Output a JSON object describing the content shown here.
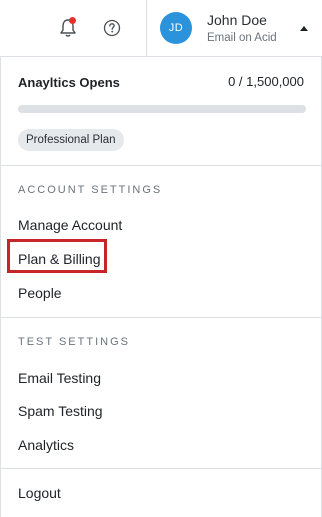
{
  "header": {
    "bell_icon": "bell-icon",
    "help_icon": "question-circle-icon",
    "notification_dot_color": "#e1342b"
  },
  "user": {
    "initials": "JD",
    "name": "John Doe",
    "company": "Email on Acid",
    "avatar_color": "#2b93dc"
  },
  "usage": {
    "title": "Anayltics Opens",
    "count": "0 / 1,500,000",
    "progress_fraction": 0,
    "plan_badge": "Professional Plan"
  },
  "account_settings": {
    "label": "ACCOUNT SETTINGS",
    "items": [
      "Manage Account",
      "Plan & Billing",
      "People"
    ],
    "highlighted_item": "Plan & Billing",
    "highlight_color": "#c8252b"
  },
  "test_settings": {
    "label": "TEST SETTINGS",
    "items": [
      "Email Testing",
      "Spam Testing",
      "Analytics"
    ]
  },
  "logout": {
    "label": "Logout"
  }
}
